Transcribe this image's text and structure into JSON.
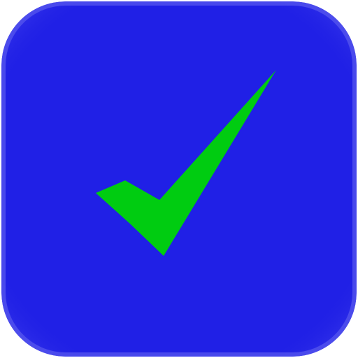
{
  "icon": {
    "name": "checkmark-icon",
    "background_color": "#2020e6",
    "edge_highlight_color": "#6f6ff0",
    "check_color": "#00cc11"
  }
}
